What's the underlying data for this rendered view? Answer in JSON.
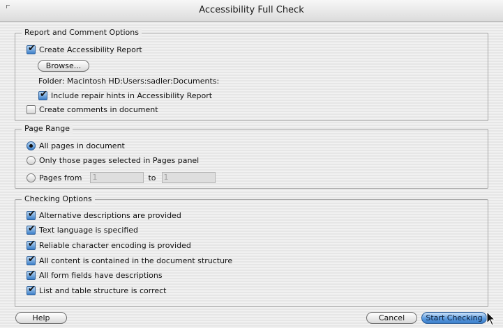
{
  "window": {
    "title": "Accessibility Full Check"
  },
  "report_options": {
    "legend": "Report and Comment Options",
    "create_report": {
      "label": "Create Accessibility Report",
      "checked": true
    },
    "browse_button": "Browse...",
    "folder_text": "Folder: Macintosh HD:Users:sadler:Documents:",
    "repair_hints": {
      "label": "Include repair hints in Accessibility Report",
      "checked": true
    },
    "create_comments": {
      "label": "Create comments in document",
      "checked": false
    }
  },
  "page_range": {
    "legend": "Page Range",
    "options": [
      {
        "label": "All pages in document",
        "selected": true
      },
      {
        "label": "Only those pages selected in Pages panel",
        "selected": false
      },
      {
        "label": "Pages from",
        "selected": false
      }
    ],
    "from_value": "1",
    "to_label": "to",
    "to_value": "1"
  },
  "checking_options": {
    "legend": "Checking Options",
    "items": [
      {
        "label": "Alternative descriptions are provided",
        "checked": true
      },
      {
        "label": "Text language is specified",
        "checked": true
      },
      {
        "label": "Reliable character encoding is provided",
        "checked": true
      },
      {
        "label": "All content is contained in the document structure",
        "checked": true
      },
      {
        "label": "All form fields have descriptions",
        "checked": true
      },
      {
        "label": "List and table structure is correct",
        "checked": true
      }
    ]
  },
  "buttons": {
    "help": "Help",
    "cancel": "Cancel",
    "start": "Start Checking"
  },
  "colors": {
    "default_button": "#4f93dc",
    "checkbox_checked": "#3c7fc9",
    "window_background": "#ececec"
  },
  "icons": {
    "cursor": "arrow-cursor-icon",
    "window-corner": "resize-corner-icon"
  }
}
